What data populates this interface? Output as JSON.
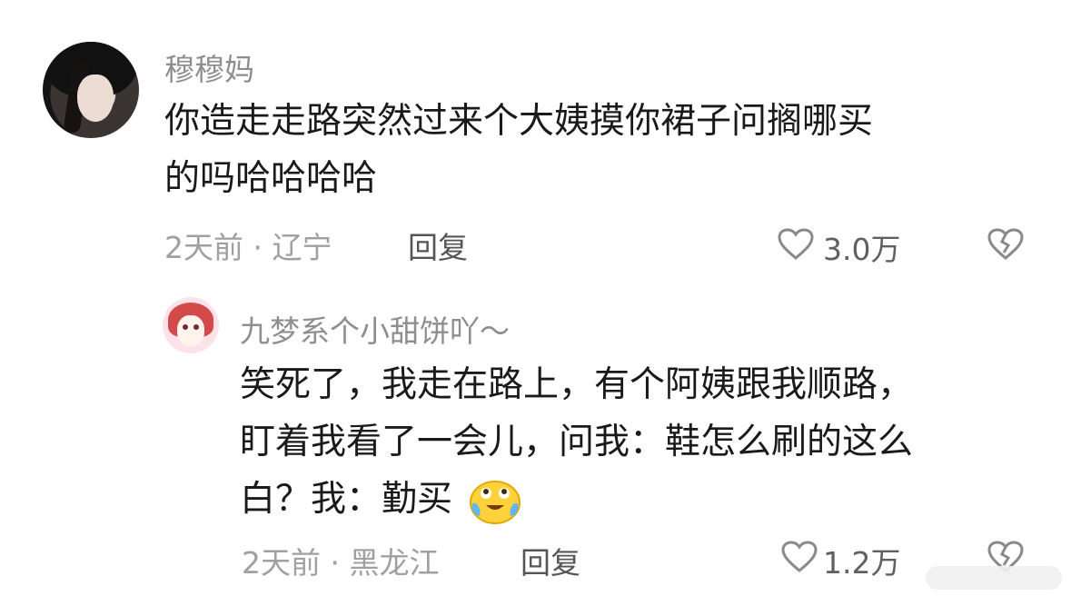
{
  "comment": {
    "username": "穆穆妈",
    "content_line1": "你造走走路突然过来个大姨摸你裙子问搁哪买",
    "content_line2": "的吗哈哈哈哈",
    "time_location": "2天前 · 辽宁",
    "reply_label": "回复",
    "like_count": "3.0万"
  },
  "sub_comment": {
    "username": "九梦系个小甜饼吖～",
    "content_line1": "笑死了，我走在路上，有个阿姨跟我顺路，",
    "content_line2": "盯着我看了一会儿，问我：鞋怎么刷的这么",
    "content_line3": "白？我：勤买",
    "emoji": "crying-laughing-emoji",
    "time_location": "2天前 · 黑龙江",
    "reply_label": "回复",
    "like_count": "1.2万"
  },
  "icons": {
    "like": "heart-outline-icon",
    "dislike": "broken-heart-icon"
  }
}
